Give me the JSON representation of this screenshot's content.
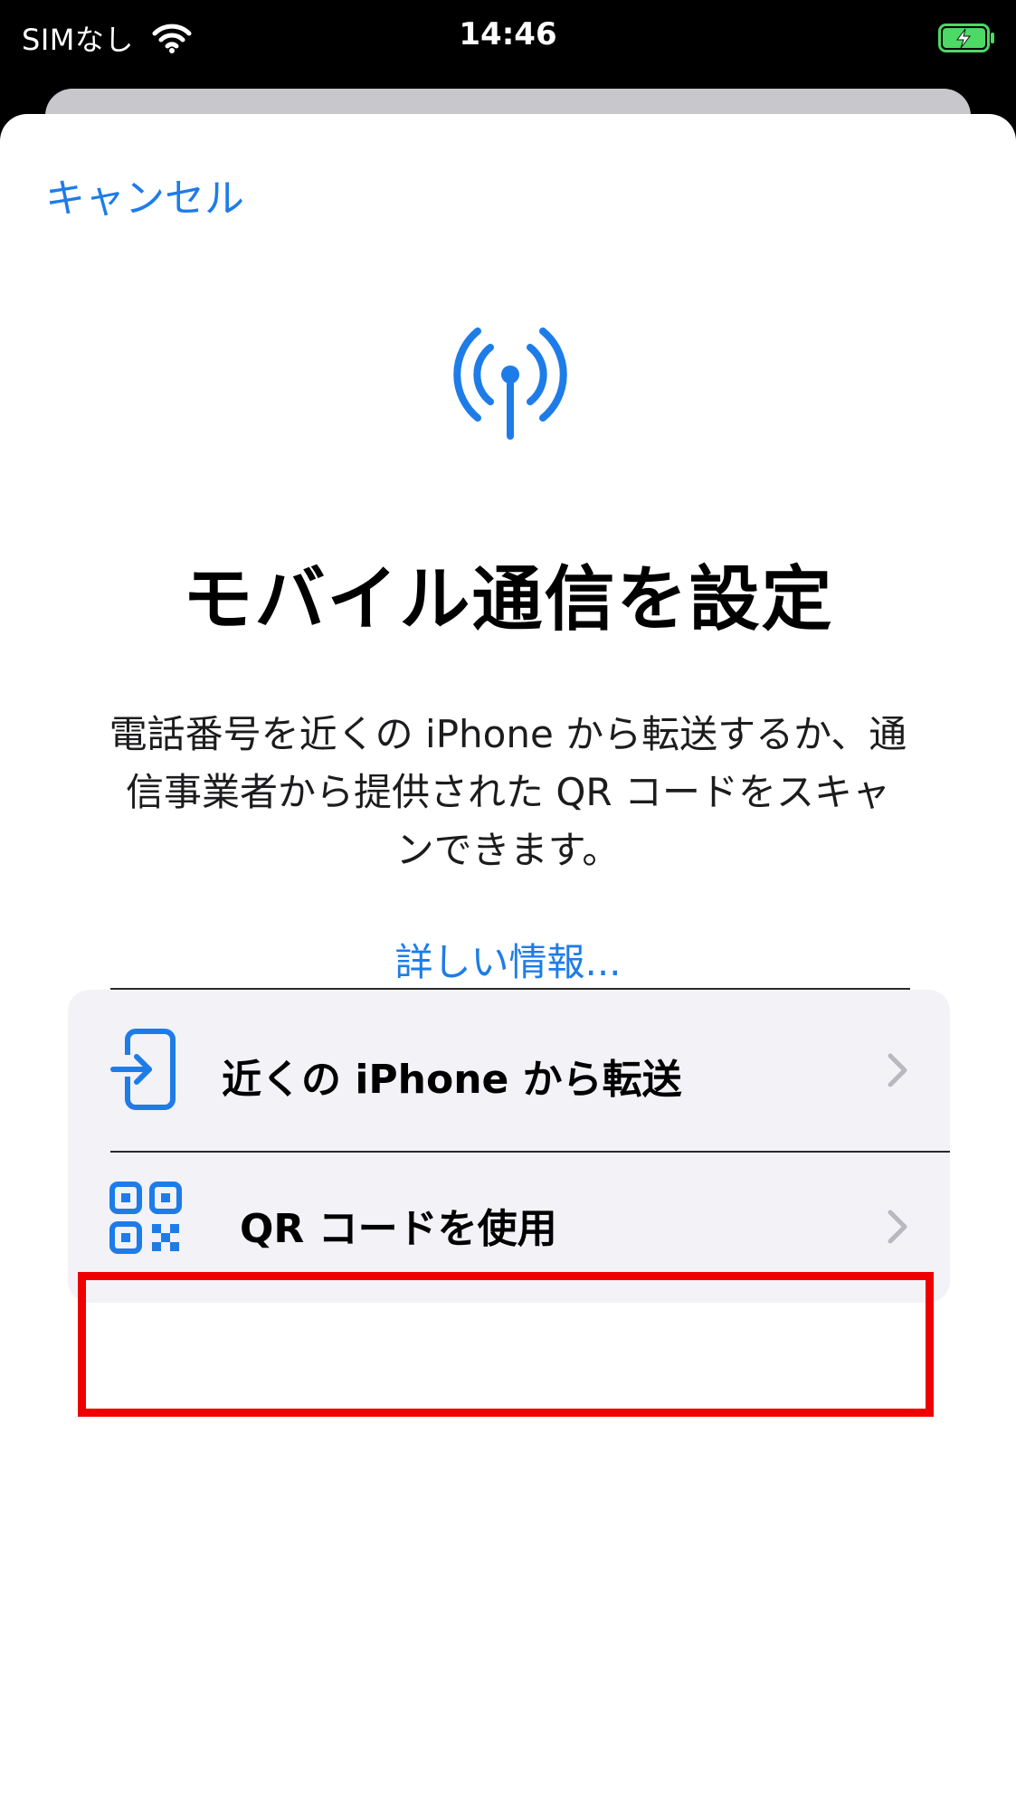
{
  "status_bar": {
    "carrier": "SIMなし",
    "time": "14:46"
  },
  "sheet": {
    "cancel_label": "キャンセル",
    "title": "モバイル通信を設定",
    "description_line1": "電話番号を近くの iPhone から転送するか、通",
    "description_line2": "信事業者から提供された QR コードをスキャ",
    "description_line3": "ンできます。",
    "more_info_link": "詳しい情報...",
    "options": [
      {
        "label": "近くの iPhone から転送",
        "icon": "transfer-in-icon"
      },
      {
        "label": "QR コードを使用",
        "icon": "qr-code-icon"
      }
    ]
  },
  "colors": {
    "accent": "#1e7ce8",
    "highlight": "#ee0000",
    "card_bg": "#f2f2f7",
    "chevron": "#b8b8be"
  }
}
